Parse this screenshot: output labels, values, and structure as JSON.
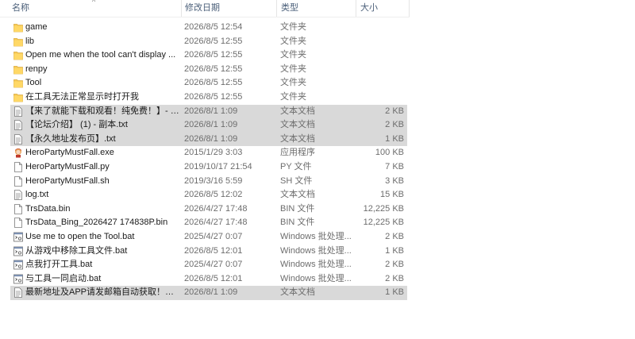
{
  "header": {
    "name": "名称",
    "date": "修改日期",
    "type": "类型",
    "size": "大小",
    "sort_arrow": "^"
  },
  "files": [
    {
      "name": "game",
      "date": "2026/8/5 12:54",
      "type": "文件夹",
      "size": "",
      "icon": "folder-icon",
      "selected": false
    },
    {
      "name": "lib",
      "date": "2026/8/5 12:55",
      "type": "文件夹",
      "size": "",
      "icon": "folder-icon",
      "selected": false
    },
    {
      "name": "Open me when the tool can't display ...",
      "date": "2026/8/5 12:55",
      "type": "文件夹",
      "size": "",
      "icon": "folder-icon",
      "selected": false
    },
    {
      "name": "renpy",
      "date": "2026/8/5 12:55",
      "type": "文件夹",
      "size": "",
      "icon": "folder-icon",
      "selected": false
    },
    {
      "name": "Tool",
      "date": "2026/8/5 12:55",
      "type": "文件夹",
      "size": "",
      "icon": "folder-icon",
      "selected": false
    },
    {
      "name": "在工具无法正常显示时打开我",
      "date": "2026/8/5 12:55",
      "type": "文件夹",
      "size": "",
      "icon": "folder-icon",
      "selected": false
    },
    {
      "name": "【来了就能下载和观看！纯免费！】- 副...",
      "date": "2026/8/1 1:09",
      "type": "文本文档",
      "size": "2 KB",
      "icon": "text-document-icon",
      "selected": true
    },
    {
      "name": "【论坛介绍】 (1) - 副本.txt",
      "date": "2026/8/1 1:09",
      "type": "文本文档",
      "size": "2 KB",
      "icon": "text-document-icon",
      "selected": true
    },
    {
      "name": "【永久地址发布页】.txt",
      "date": "2026/8/1 1:09",
      "type": "文本文档",
      "size": "1 KB",
      "icon": "text-document-icon",
      "selected": true
    },
    {
      "name": "HeroPartyMustFall.exe",
      "date": "2015/1/29 3:03",
      "type": "应用程序",
      "size": "100 KB",
      "icon": "application-icon",
      "selected": false
    },
    {
      "name": "HeroPartyMustFall.py",
      "date": "2019/10/17 21:54",
      "type": "PY 文件",
      "size": "7 KB",
      "icon": "blank-file-icon",
      "selected": false
    },
    {
      "name": "HeroPartyMustFall.sh",
      "date": "2019/3/16 5:59",
      "type": "SH 文件",
      "size": "3 KB",
      "icon": "blank-file-icon",
      "selected": false
    },
    {
      "name": "log.txt",
      "date": "2026/8/5 12:02",
      "type": "文本文档",
      "size": "15 KB",
      "icon": "text-document-icon",
      "selected": false
    },
    {
      "name": "TrsData.bin",
      "date": "2026/4/27 17:48",
      "type": "BIN 文件",
      "size": "12,225 KB",
      "icon": "blank-file-icon",
      "selected": false
    },
    {
      "name": "TrsData_Bing_2026427 174838P.bin",
      "date": "2026/4/27 17:48",
      "type": "BIN 文件",
      "size": "12,225 KB",
      "icon": "blank-file-icon",
      "selected": false
    },
    {
      "name": "Use me to open the Tool.bat",
      "date": "2025/4/27 0:07",
      "type": "Windows 批处理...",
      "size": "2 KB",
      "icon": "batch-file-icon",
      "selected": false
    },
    {
      "name": "从游戏中移除工具文件.bat",
      "date": "2026/8/5 12:01",
      "type": "Windows 批处理...",
      "size": "1 KB",
      "icon": "batch-file-icon",
      "selected": false
    },
    {
      "name": "点我打开工具.bat",
      "date": "2025/4/27 0:07",
      "type": "Windows 批处理...",
      "size": "2 KB",
      "icon": "batch-file-icon",
      "selected": false
    },
    {
      "name": "与工具一同启动.bat",
      "date": "2026/8/5 12:01",
      "type": "Windows 批处理...",
      "size": "2 KB",
      "icon": "batch-file-icon",
      "selected": false
    },
    {
      "name": "最新地址及APP请发邮箱自动获取！！！...",
      "date": "2026/8/1 1:09",
      "type": "文本文档",
      "size": "1 KB",
      "icon": "text-document-icon",
      "selected": true
    }
  ]
}
